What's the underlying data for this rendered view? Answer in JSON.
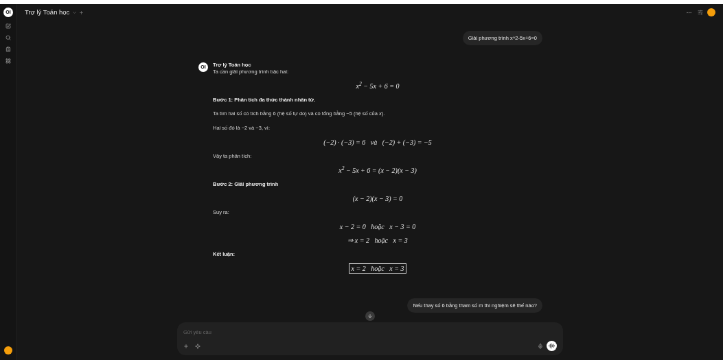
{
  "header": {
    "logo": "OI",
    "title": "Trợ lý Toán học"
  },
  "messages": [
    {
      "kind": "user",
      "text": "Giải phương trình x^2-5x+6=0"
    },
    {
      "kind": "assistant",
      "avatar": "OI",
      "name": "Trợ lý Toán học",
      "blocks": [
        {
          "kind": "text",
          "text": "Ta cần giải phương trình bậc hai:"
        },
        {
          "kind": "math",
          "text": "x$^{2}$ − 5x + 6 = 0"
        },
        {
          "kind": "bold",
          "text": "Bước 1: Phân tích đa thức thành nhân tử."
        },
        {
          "kind": "text",
          "text": "Ta tìm hai số có tích bằng 6 (hệ số tự do) và có tổng bằng −5 (hệ số của *x*)."
        },
        {
          "kind": "text",
          "text": "Hai số đó là −2 và −3, vì:"
        },
        {
          "kind": "math",
          "text": "(−2) · (−3) = 6   và   (−2) + (−3) = −5"
        },
        {
          "kind": "text",
          "text": "Vậy ta phân tích:"
        },
        {
          "kind": "math",
          "text": "x$^{2}$ − 5x + 6 = (x − 2)(x − 3)"
        },
        {
          "kind": "bold",
          "text": "Bước 2: Giải phương trình"
        },
        {
          "kind": "math",
          "text": "(x − 2)(x − 3) = 0"
        },
        {
          "kind": "text",
          "text": "Suy ra:"
        },
        {
          "kind": "math",
          "text": "x − 2 = 0   hoặc   x − 3 = 0"
        },
        {
          "kind": "math",
          "text": "⇒ x = 2   hoặc   x = 3"
        },
        {
          "kind": "bold",
          "text": "Kết luận:"
        },
        {
          "kind": "boxed",
          "text": "x = 2   hoặc   x = 3"
        }
      ]
    },
    {
      "kind": "user",
      "text": "Nếu thay số 6 bằng tham số m thì nghiệm sẽ thế nào?"
    }
  ],
  "composer": {
    "placeholder": "Gửi yêu cầu"
  }
}
